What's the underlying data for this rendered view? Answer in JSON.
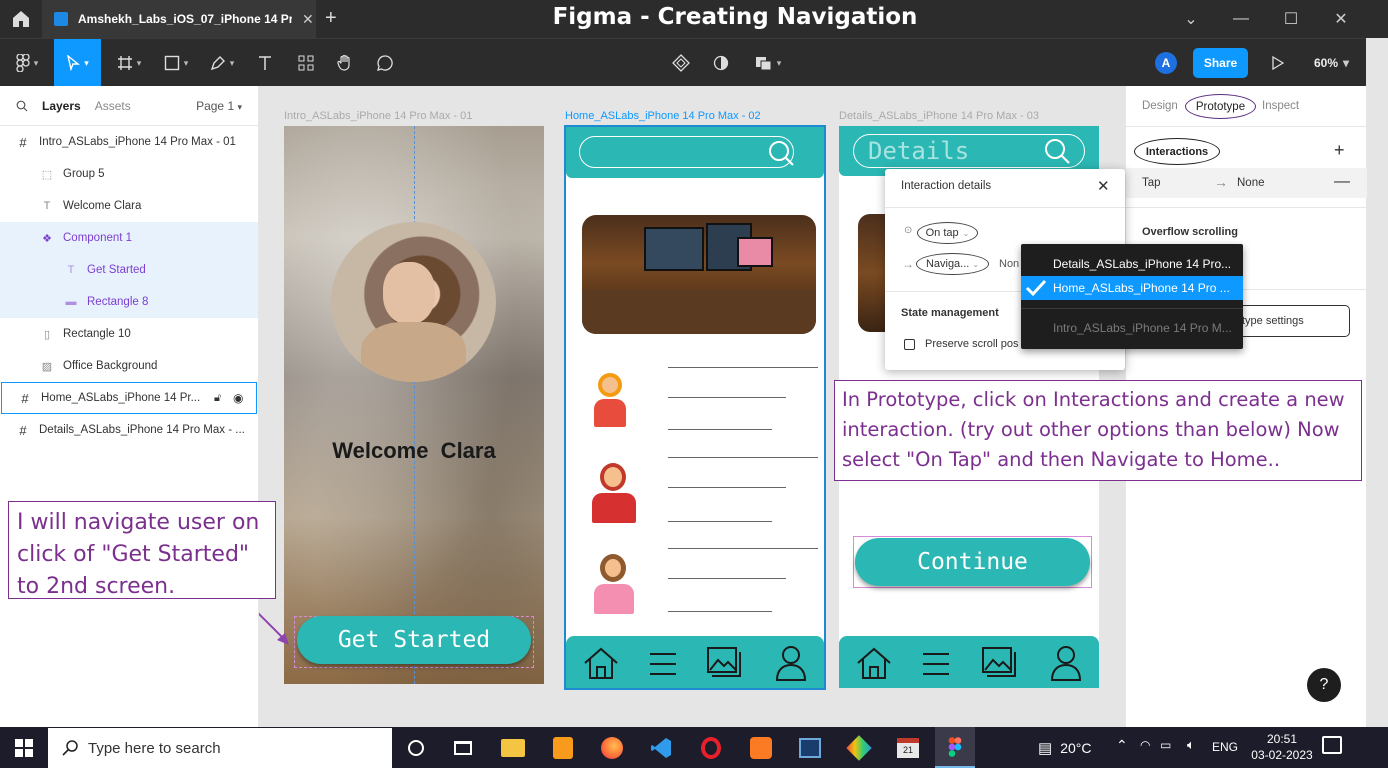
{
  "window": {
    "title": "Figma - Creating Navigation",
    "tab_label": "Amshekh_Labs_iOS_07_iPhone 14 Pro Max",
    "new_tab": "+"
  },
  "toolbar": {
    "avatar_initial": "A",
    "share_label": "Share",
    "zoom": "60%"
  },
  "layers_panel": {
    "tabs": [
      "Layers",
      "Assets"
    ],
    "page": "Page 1",
    "items": [
      {
        "label": "Intro_ASLabs_iPhone 14 Pro Max - 01",
        "icon": "frame-icon"
      },
      {
        "label": "Group 5",
        "icon": "group-icon"
      },
      {
        "label": "Welcome Clara",
        "icon": "text-icon"
      },
      {
        "label": "Component 1",
        "icon": "component-icon"
      },
      {
        "label": "Get Started",
        "icon": "text-icon"
      },
      {
        "label": "Rectangle 8",
        "icon": "rectangle-icon"
      },
      {
        "label": "Rectangle 10",
        "icon": "rectangle-icon"
      },
      {
        "label": "Office Background",
        "icon": "image-icon"
      },
      {
        "label": "Home_ASLabs_iPhone 14 Pr...",
        "icon": "frame-icon"
      },
      {
        "label": "Details_ASLabs_iPhone 14 Pro Max - ...",
        "icon": "frame-icon"
      }
    ]
  },
  "canvas": {
    "frames": [
      {
        "label": "Intro_ASLabs_iPhone 14 Pro Max - 01"
      },
      {
        "label": "Home_ASLabs_iPhone 14 Pro Max - 02"
      },
      {
        "label": "Details_ASLabs_iPhone 14 Pro Max - 03"
      }
    ],
    "intro": {
      "welcome": "Welcome  Clara",
      "button": "Get Started"
    },
    "details": {
      "search_text": "Details",
      "button": "Continue"
    },
    "annotation_left": "I will navigate user on click of \"Get Started\" to 2nd screen.",
    "annotation_right": "In Prototype, click on Interactions and create a new interaction. (try out other options than below) Now select \"On Tap\" and then Navigate to Home.."
  },
  "interaction_popup": {
    "title": "Interaction details",
    "trigger": "On tap",
    "action": "Naviga...",
    "destination_partial": "Non",
    "state_heading": "State management",
    "preserve_label": "Preserve scroll pos"
  },
  "destination_menu": {
    "items": [
      {
        "label": "Details_ASLabs_iPhone 14 Pro...",
        "selected": false
      },
      {
        "label": "Home_ASLabs_iPhone 14 Pro ...",
        "selected": true
      },
      {
        "label": "Intro_ASLabs_iPhone 14 Pro M...",
        "selected": false
      }
    ]
  },
  "right_panel": {
    "tabs": [
      "Design",
      "Prototype",
      "Inspect"
    ],
    "interactions_label": "Interactions",
    "interaction_trigger": "Tap",
    "interaction_target": "None",
    "overflow_label": "Overflow scrolling",
    "settings_button_partial": "type settings",
    "help": "?"
  },
  "taskbar": {
    "search_placeholder": "Type here to search",
    "weather": "20°C",
    "language": "ENG",
    "time": "20:51",
    "date": "03-02-2023"
  },
  "colors": {
    "accent_teal": "#2bb7b3",
    "figma_blue": "#0d99ff",
    "annotation_purple": "#7b2f8e",
    "selection_blue": "#1f8ad2"
  }
}
